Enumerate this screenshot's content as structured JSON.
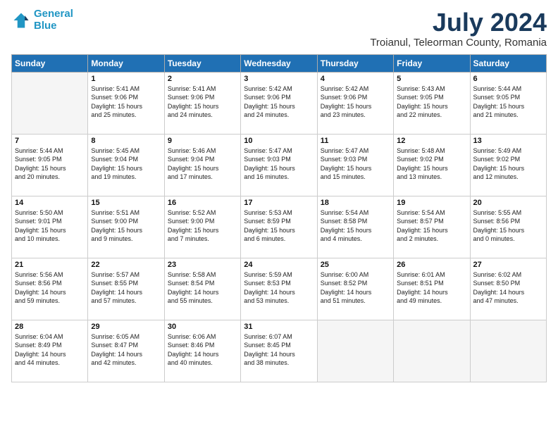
{
  "header": {
    "logo_line1": "General",
    "logo_line2": "Blue",
    "main_title": "July 2024",
    "subtitle": "Troianul, Teleorman County, Romania"
  },
  "days_of_week": [
    "Sunday",
    "Monday",
    "Tuesday",
    "Wednesday",
    "Thursday",
    "Friday",
    "Saturday"
  ],
  "weeks": [
    [
      {
        "num": "",
        "info": ""
      },
      {
        "num": "1",
        "info": "Sunrise: 5:41 AM\nSunset: 9:06 PM\nDaylight: 15 hours\nand 25 minutes."
      },
      {
        "num": "2",
        "info": "Sunrise: 5:41 AM\nSunset: 9:06 PM\nDaylight: 15 hours\nand 24 minutes."
      },
      {
        "num": "3",
        "info": "Sunrise: 5:42 AM\nSunset: 9:06 PM\nDaylight: 15 hours\nand 24 minutes."
      },
      {
        "num": "4",
        "info": "Sunrise: 5:42 AM\nSunset: 9:06 PM\nDaylight: 15 hours\nand 23 minutes."
      },
      {
        "num": "5",
        "info": "Sunrise: 5:43 AM\nSunset: 9:05 PM\nDaylight: 15 hours\nand 22 minutes."
      },
      {
        "num": "6",
        "info": "Sunrise: 5:44 AM\nSunset: 9:05 PM\nDaylight: 15 hours\nand 21 minutes."
      }
    ],
    [
      {
        "num": "7",
        "info": "Sunrise: 5:44 AM\nSunset: 9:05 PM\nDaylight: 15 hours\nand 20 minutes."
      },
      {
        "num": "8",
        "info": "Sunrise: 5:45 AM\nSunset: 9:04 PM\nDaylight: 15 hours\nand 19 minutes."
      },
      {
        "num": "9",
        "info": "Sunrise: 5:46 AM\nSunset: 9:04 PM\nDaylight: 15 hours\nand 17 minutes."
      },
      {
        "num": "10",
        "info": "Sunrise: 5:47 AM\nSunset: 9:03 PM\nDaylight: 15 hours\nand 16 minutes."
      },
      {
        "num": "11",
        "info": "Sunrise: 5:47 AM\nSunset: 9:03 PM\nDaylight: 15 hours\nand 15 minutes."
      },
      {
        "num": "12",
        "info": "Sunrise: 5:48 AM\nSunset: 9:02 PM\nDaylight: 15 hours\nand 13 minutes."
      },
      {
        "num": "13",
        "info": "Sunrise: 5:49 AM\nSunset: 9:02 PM\nDaylight: 15 hours\nand 12 minutes."
      }
    ],
    [
      {
        "num": "14",
        "info": "Sunrise: 5:50 AM\nSunset: 9:01 PM\nDaylight: 15 hours\nand 10 minutes."
      },
      {
        "num": "15",
        "info": "Sunrise: 5:51 AM\nSunset: 9:00 PM\nDaylight: 15 hours\nand 9 minutes."
      },
      {
        "num": "16",
        "info": "Sunrise: 5:52 AM\nSunset: 9:00 PM\nDaylight: 15 hours\nand 7 minutes."
      },
      {
        "num": "17",
        "info": "Sunrise: 5:53 AM\nSunset: 8:59 PM\nDaylight: 15 hours\nand 6 minutes."
      },
      {
        "num": "18",
        "info": "Sunrise: 5:54 AM\nSunset: 8:58 PM\nDaylight: 15 hours\nand 4 minutes."
      },
      {
        "num": "19",
        "info": "Sunrise: 5:54 AM\nSunset: 8:57 PM\nDaylight: 15 hours\nand 2 minutes."
      },
      {
        "num": "20",
        "info": "Sunrise: 5:55 AM\nSunset: 8:56 PM\nDaylight: 15 hours\nand 0 minutes."
      }
    ],
    [
      {
        "num": "21",
        "info": "Sunrise: 5:56 AM\nSunset: 8:56 PM\nDaylight: 14 hours\nand 59 minutes."
      },
      {
        "num": "22",
        "info": "Sunrise: 5:57 AM\nSunset: 8:55 PM\nDaylight: 14 hours\nand 57 minutes."
      },
      {
        "num": "23",
        "info": "Sunrise: 5:58 AM\nSunset: 8:54 PM\nDaylight: 14 hours\nand 55 minutes."
      },
      {
        "num": "24",
        "info": "Sunrise: 5:59 AM\nSunset: 8:53 PM\nDaylight: 14 hours\nand 53 minutes."
      },
      {
        "num": "25",
        "info": "Sunrise: 6:00 AM\nSunset: 8:52 PM\nDaylight: 14 hours\nand 51 minutes."
      },
      {
        "num": "26",
        "info": "Sunrise: 6:01 AM\nSunset: 8:51 PM\nDaylight: 14 hours\nand 49 minutes."
      },
      {
        "num": "27",
        "info": "Sunrise: 6:02 AM\nSunset: 8:50 PM\nDaylight: 14 hours\nand 47 minutes."
      }
    ],
    [
      {
        "num": "28",
        "info": "Sunrise: 6:04 AM\nSunset: 8:49 PM\nDaylight: 14 hours\nand 44 minutes."
      },
      {
        "num": "29",
        "info": "Sunrise: 6:05 AM\nSunset: 8:47 PM\nDaylight: 14 hours\nand 42 minutes."
      },
      {
        "num": "30",
        "info": "Sunrise: 6:06 AM\nSunset: 8:46 PM\nDaylight: 14 hours\nand 40 minutes."
      },
      {
        "num": "31",
        "info": "Sunrise: 6:07 AM\nSunset: 8:45 PM\nDaylight: 14 hours\nand 38 minutes."
      },
      {
        "num": "",
        "info": ""
      },
      {
        "num": "",
        "info": ""
      },
      {
        "num": "",
        "info": ""
      }
    ]
  ]
}
